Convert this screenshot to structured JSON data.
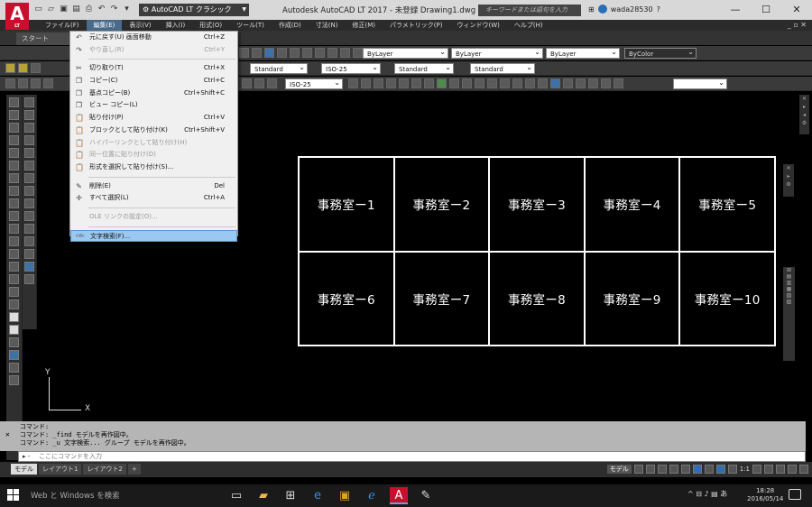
{
  "title_bar": {
    "logo_letter": "A",
    "logo_sub": "LT",
    "workspace": "AutoCAD LT クラシック",
    "title": "Autodesk AutoCAD LT 2017 - 未登録    Drawing1.dwg",
    "search_placeholder": "キーワードまたは語句を入力",
    "username": "wada28530"
  },
  "menubar": {
    "items": [
      "ファイル(F)",
      "編集(E)",
      "表示(V)",
      "挿入(I)",
      "形式(O)",
      "ツール(T)",
      "作成(D)",
      "寸法(N)",
      "修正(M)",
      "パラメトリック(P)",
      "ウィンドウ(W)",
      "ヘルプ(H)"
    ]
  },
  "tabs": {
    "start": "スタート"
  },
  "toolbars": {
    "layer": "ByLayer",
    "linetype": "ByLayer",
    "lineweight": "ByLayer",
    "color": "ByColor",
    "text_style": "Standard",
    "dim_style": "ISO-25",
    "table_style": "Standard",
    "mleader_style": "Standard",
    "dim_style_2": "ISO-25"
  },
  "edit_menu": {
    "items": [
      {
        "icon": "↶",
        "label": "元に戻す(U) 画面移動",
        "shortcut": "Ctrl+Z",
        "disabled": false
      },
      {
        "icon": "↷",
        "label": "やり直し(R)",
        "shortcut": "Ctrl+Y",
        "disabled": true
      },
      {
        "icon": "✂",
        "label": "切り取り(T)",
        "shortcut": "Ctrl+X",
        "disabled": false
      },
      {
        "icon": "❐",
        "label": "コピー(C)",
        "shortcut": "Ctrl+C",
        "disabled": false
      },
      {
        "icon": "❐",
        "label": "基点コピー(B)",
        "shortcut": "Ctrl+Shift+C",
        "disabled": false
      },
      {
        "icon": "❐",
        "label": "ビュー コピー(L)",
        "shortcut": "",
        "disabled": false
      },
      {
        "icon": "📋",
        "label": "貼り付け(P)",
        "shortcut": "Ctrl+V",
        "disabled": false
      },
      {
        "icon": "📋",
        "label": "ブロックとして貼り付け(K)",
        "shortcut": "Ctrl+Shift+V",
        "disabled": false
      },
      {
        "icon": "📋",
        "label": "ハイパーリンクとして貼り付け(H)",
        "shortcut": "",
        "disabled": true
      },
      {
        "icon": "📋",
        "label": "同一位置に貼り付け(D)",
        "shortcut": "",
        "disabled": true
      },
      {
        "icon": "📋",
        "label": "形式を選択して貼り付け(S)...",
        "shortcut": "",
        "disabled": false
      },
      {
        "icon": "✎",
        "label": "削除(E)",
        "shortcut": "Del",
        "disabled": false
      },
      {
        "icon": "✛",
        "label": "すべて選択(L)",
        "shortcut": "Ctrl+A",
        "disabled": false
      },
      {
        "icon": "",
        "label": "OLE リンクの設定(O)...",
        "shortcut": "",
        "disabled": true
      },
      {
        "icon": "ᴬᴮᶜ",
        "label": "文字検索(F)...",
        "shortcut": "",
        "disabled": false,
        "highlight": true
      }
    ]
  },
  "drawing": {
    "cells": [
      "事務室ー1",
      "事務室ー2",
      "事務室ー3",
      "事務室ー4",
      "事務室ー5",
      "事務室ー6",
      "事務室ー7",
      "事務室ー8",
      "事務室ー9",
      "事務室ー10"
    ],
    "ucs_x": "X",
    "ucs_y": "Y"
  },
  "command_line": {
    "history": [
      "コマンド:",
      "コマンド:  _find モデルを再作図中。",
      "コマンド:  _u 文字検索... グループ モデルを再作図中。"
    ],
    "placeholder": "ここにコマンドを入力"
  },
  "layout_tabs": [
    "モデル",
    "レイアウト1",
    "レイアウト2",
    "+"
  ],
  "status_bar": {
    "model": "モデル",
    "scale": "1:1"
  },
  "taskbar": {
    "search": "Web と Windows を検索",
    "clock_time": "18:28",
    "clock_date": "2016/05/14",
    "ime": "あ"
  }
}
